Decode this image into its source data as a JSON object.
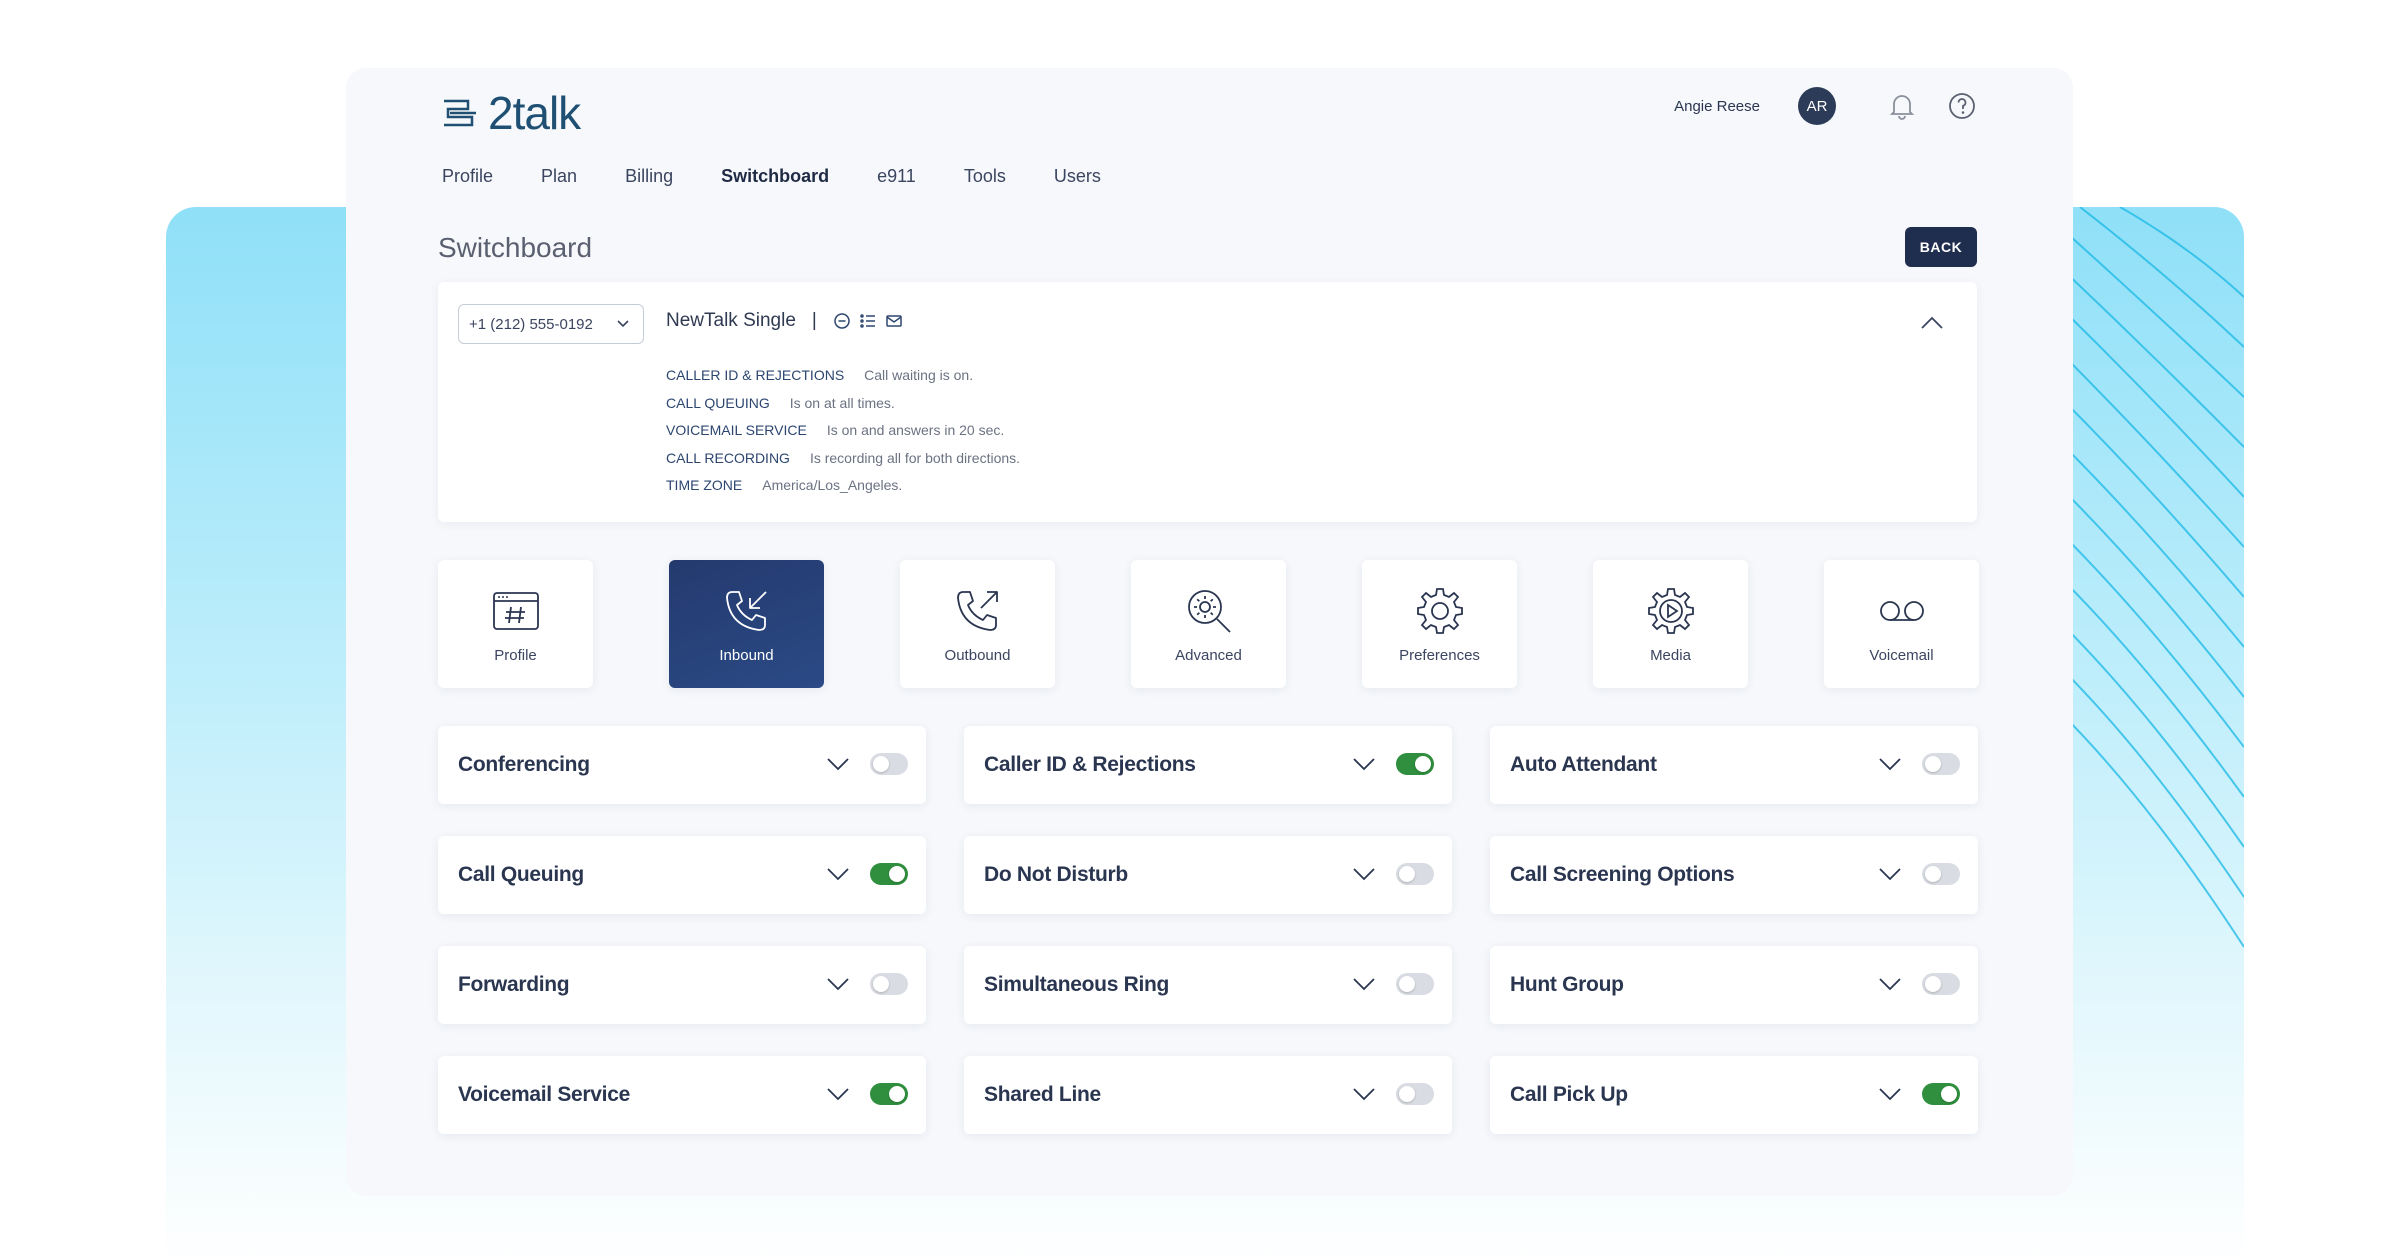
{
  "app": {
    "logo_text": "2talk",
    "user_name": "Angie Reese",
    "avatar_initials": "AR"
  },
  "nav": {
    "items": [
      {
        "label": "Profile",
        "active": false
      },
      {
        "label": "Plan",
        "active": false
      },
      {
        "label": "Billing",
        "active": false
      },
      {
        "label": "Switchboard",
        "active": true
      },
      {
        "label": "e911",
        "active": false
      },
      {
        "label": "Tools",
        "active": false
      },
      {
        "label": "Users",
        "active": false
      }
    ]
  },
  "page": {
    "title": "Switchboard",
    "back_label": "BACK"
  },
  "info": {
    "selected_number": "+1 (212) 555-0192",
    "plan_name": "NewTalk Single",
    "separator": "|",
    "summary": [
      {
        "key": "CALLER ID & REJECTIONS",
        "value": "Call waiting is on."
      },
      {
        "key": "CALL QUEUING",
        "value": "Is on at all times."
      },
      {
        "key": "VOICEMAIL SERVICE",
        "value": "Is on and answers in 20 sec."
      },
      {
        "key": "CALL RECORDING",
        "value": "Is recording all for both directions."
      },
      {
        "key": "TIME ZONE",
        "value": "America/Los_Angeles."
      }
    ]
  },
  "categories": [
    {
      "label": "Profile",
      "icon": "hash-window-icon",
      "active": false
    },
    {
      "label": "Inbound",
      "icon": "phone-inbound-icon",
      "active": true
    },
    {
      "label": "Outbound",
      "icon": "phone-outbound-icon",
      "active": false
    },
    {
      "label": "Advanced",
      "icon": "gear-search-icon",
      "active": false
    },
    {
      "label": "Preferences",
      "icon": "gear-icon",
      "active": false
    },
    {
      "label": "Media",
      "icon": "gear-play-icon",
      "active": false
    },
    {
      "label": "Voicemail",
      "icon": "voicemail-icon",
      "active": false
    }
  ],
  "features": [
    {
      "label": "Conferencing",
      "on": false
    },
    {
      "label": "Caller ID & Rejections",
      "on": true
    },
    {
      "label": "Auto Attendant",
      "on": false
    },
    {
      "label": "Call Queuing",
      "on": true
    },
    {
      "label": "Do Not Disturb",
      "on": false
    },
    {
      "label": "Call Screening Options",
      "on": false
    },
    {
      "label": "Forwarding",
      "on": false
    },
    {
      "label": "Simultaneous Ring",
      "on": false
    },
    {
      "label": "Hunt Group",
      "on": false
    },
    {
      "label": "Voicemail Service",
      "on": true
    },
    {
      "label": "Shared Line",
      "on": false
    },
    {
      "label": "Call Pick Up",
      "on": true
    }
  ],
  "colors": {
    "primary_navy": "#1f2d4f",
    "toggle_on": "#2f8f3e",
    "toggle_off": "#d9dce2",
    "accent_cyan": "#8fe0f8"
  }
}
